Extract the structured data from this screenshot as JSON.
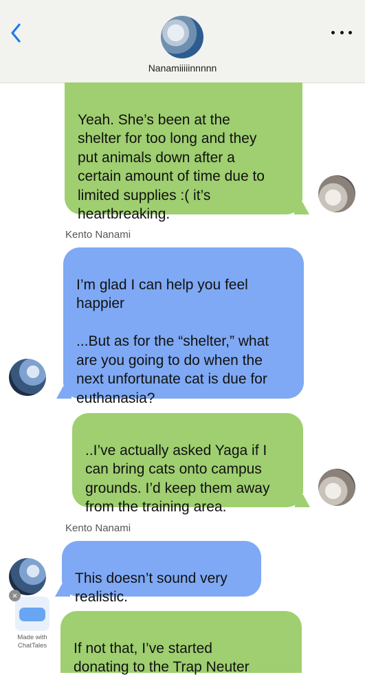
{
  "header": {
    "contact_name": "Nanamiiiiinnnnn",
    "back_icon": "chevron-left-icon",
    "more_icon": "ellipsis-icon",
    "accent_color": "#1a7cf0"
  },
  "messages": [
    {
      "side": "right",
      "color": "#9fcf70",
      "text": "Yeah. She’s been at the\nshelter for too long and they\nput animals down after a\ncertain amount of time due to\nlimited supplies :( it’s\nheartbreaking."
    },
    {
      "side": "left",
      "sender": "Kento Nanami",
      "color": "#7fa9f4",
      "text": "I’m glad I can help you feel\nhappier\n\n...But as for the “shelter,” what\nare you going to do when the\nnext unfortunate cat is due for\neuthanasia?"
    },
    {
      "side": "right",
      "color": "#9fcf70",
      "text": "..I’ve actually asked Yaga if I\ncan bring cats onto campus\ngrounds. I’d keep them away\nfrom the training area."
    },
    {
      "side": "left",
      "sender": "Kento Nanami",
      "color": "#7fa9f4",
      "text": "This doesn’t sound very\nrealistic."
    },
    {
      "side": "right",
      "color": "#9fcf70",
      "text": "If not that, I’ve started\ndonating to the Trap Neuter"
    }
  ],
  "watermark": {
    "text": "Made with\nChatTales",
    "close_glyph": "×"
  }
}
